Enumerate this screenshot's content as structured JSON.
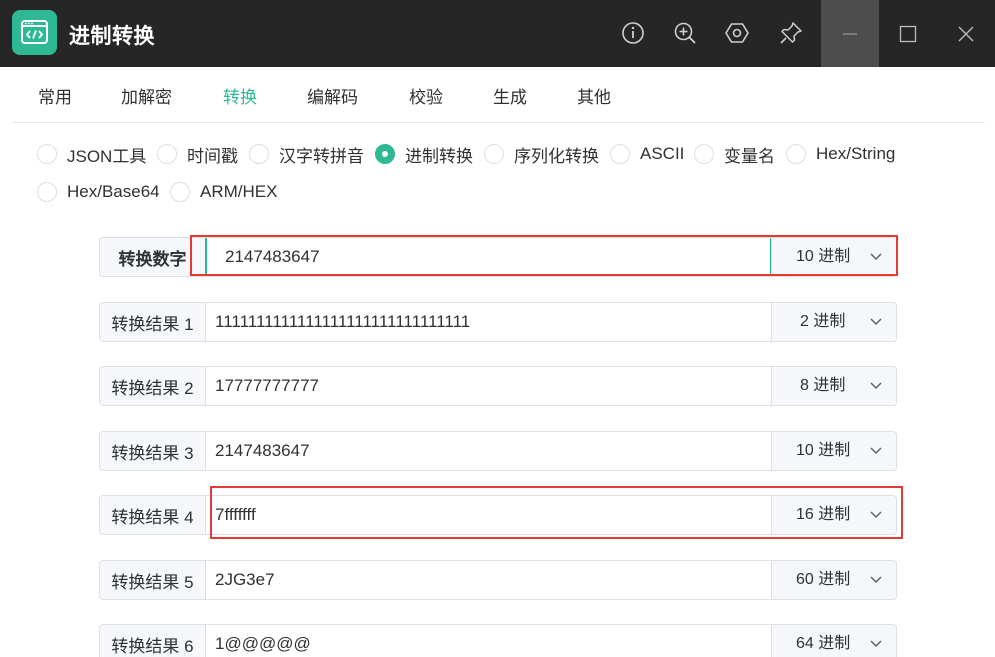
{
  "app": {
    "title": "进制转换",
    "icon": "code-window-icon"
  },
  "titlebar": {
    "buttons": [
      {
        "name": "info-icon"
      },
      {
        "name": "zoom-in-icon"
      },
      {
        "name": "settings-hex-icon"
      },
      {
        "name": "pin-icon"
      }
    ],
    "window_controls": [
      "minimize-icon",
      "maximize-icon",
      "close-icon"
    ]
  },
  "tabs": [
    {
      "label": "常用"
    },
    {
      "label": "加解密"
    },
    {
      "label": "转换",
      "active": true
    },
    {
      "label": "编解码"
    },
    {
      "label": "校验"
    },
    {
      "label": "生成"
    },
    {
      "label": "其他"
    }
  ],
  "tools": [
    {
      "label": "JSON工具"
    },
    {
      "label": "时间戳"
    },
    {
      "label": "汉字转拼音"
    },
    {
      "label": "进制转换",
      "checked": true
    },
    {
      "label": "序列化转换"
    },
    {
      "label": "ASCII"
    },
    {
      "label": "变量名"
    },
    {
      "label": "Hex/String"
    },
    {
      "label": "Hex/Base64"
    },
    {
      "label": "ARM/HEX"
    }
  ],
  "input": {
    "label": "转换数字",
    "value": "2147483647",
    "base": "10 进制"
  },
  "results": [
    {
      "label": "转换结果 1",
      "value": "1111111111111111111111111111111",
      "base": "2 进制"
    },
    {
      "label": "转换结果 2",
      "value": "17777777777",
      "base": "8 进制"
    },
    {
      "label": "转换结果 3",
      "value": "2147483647",
      "base": "10 进制"
    },
    {
      "label": "转换结果 4",
      "value": "7fffffff",
      "base": "16 进制"
    },
    {
      "label": "转换结果 5",
      "value": "2JG3e7",
      "base": "60 进制"
    },
    {
      "label": "转换结果 6",
      "value": "1@@@@@",
      "base": "64 进制"
    }
  ],
  "colors": {
    "accent": "#2fb894",
    "titlebar": "#262626",
    "highlight": "#e53935"
  }
}
